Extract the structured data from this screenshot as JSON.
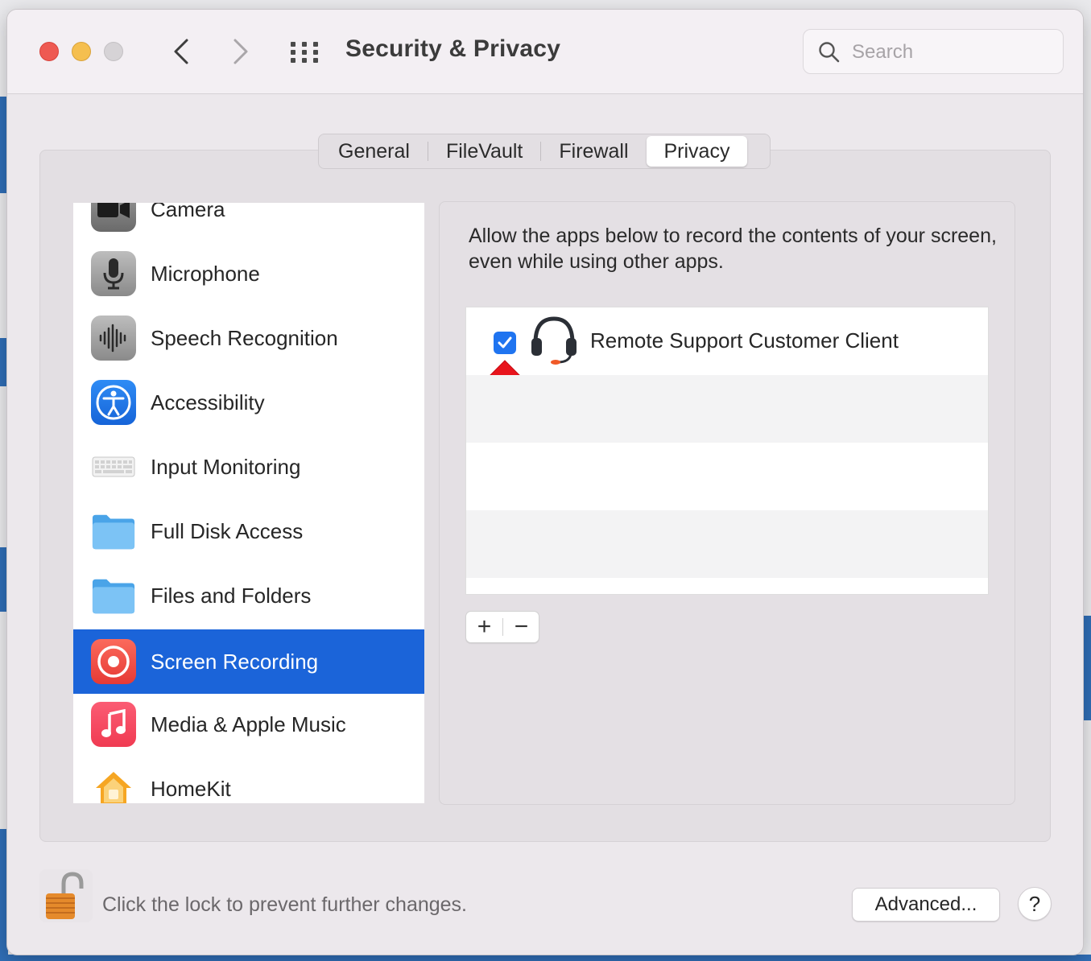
{
  "window": {
    "title": "Security & Privacy",
    "search_placeholder": "Search"
  },
  "tabs": [
    {
      "label": "General",
      "active": false
    },
    {
      "label": "FileVault",
      "active": false
    },
    {
      "label": "Firewall",
      "active": false
    },
    {
      "label": "Privacy",
      "active": true
    }
  ],
  "sidebar": {
    "items": [
      {
        "label": "Camera",
        "icon": "camera-icon"
      },
      {
        "label": "Microphone",
        "icon": "microphone-icon"
      },
      {
        "label": "Speech Recognition",
        "icon": "waveform-icon"
      },
      {
        "label": "Accessibility",
        "icon": "accessibility-icon"
      },
      {
        "label": "Input Monitoring",
        "icon": "keyboard-icon"
      },
      {
        "label": "Full Disk Access",
        "icon": "folder-icon"
      },
      {
        "label": "Files and Folders",
        "icon": "folder-icon"
      },
      {
        "label": "Screen Recording",
        "icon": "screen-record-icon",
        "selected": true
      },
      {
        "label": "Media & Apple Music",
        "icon": "music-note-icon"
      },
      {
        "label": "HomeKit",
        "icon": "home-icon"
      }
    ]
  },
  "content": {
    "description": "Allow the apps below to record the contents of your screen, even while using other apps.",
    "apps": [
      {
        "name": "Remote Support Customer Client",
        "checked": true,
        "icon": "headset-icon"
      }
    ],
    "add_label": "+",
    "remove_label": "−"
  },
  "footer": {
    "lock_text": "Click the lock to prevent further changes.",
    "advanced_label": "Advanced...",
    "help_label": "?"
  },
  "colors": {
    "selection": "#1b64d9",
    "checkbox": "#1f74f0",
    "annotation_arrow": "#e8141c"
  }
}
